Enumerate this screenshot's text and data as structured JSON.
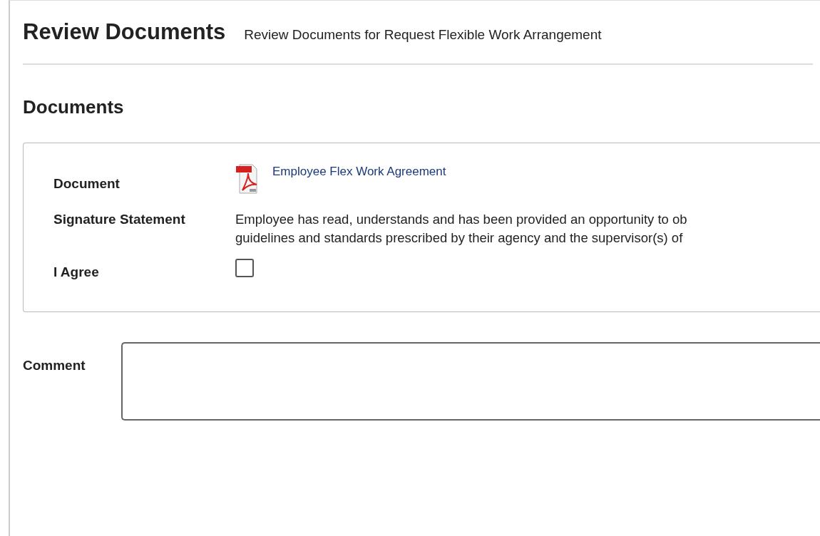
{
  "header": {
    "title": "Review Documents",
    "subtitle": "Review Documents for Request Flexible Work Arrangement"
  },
  "section": {
    "title": "Documents"
  },
  "fields": [
    {
      "kind": "document",
      "label": "Document",
      "value": "Employee Flex Work Agreement"
    },
    {
      "kind": "text",
      "label": "Signature Statement",
      "lines": [
        "Employee has read, understands and has been provided an opportunity to ob",
        "guidelines and standards prescribed by their agency and the supervisor(s) of"
      ]
    },
    {
      "kind": "checkbox",
      "label": "I Agree",
      "checked": false
    }
  ],
  "comment": {
    "label": "Comment"
  }
}
